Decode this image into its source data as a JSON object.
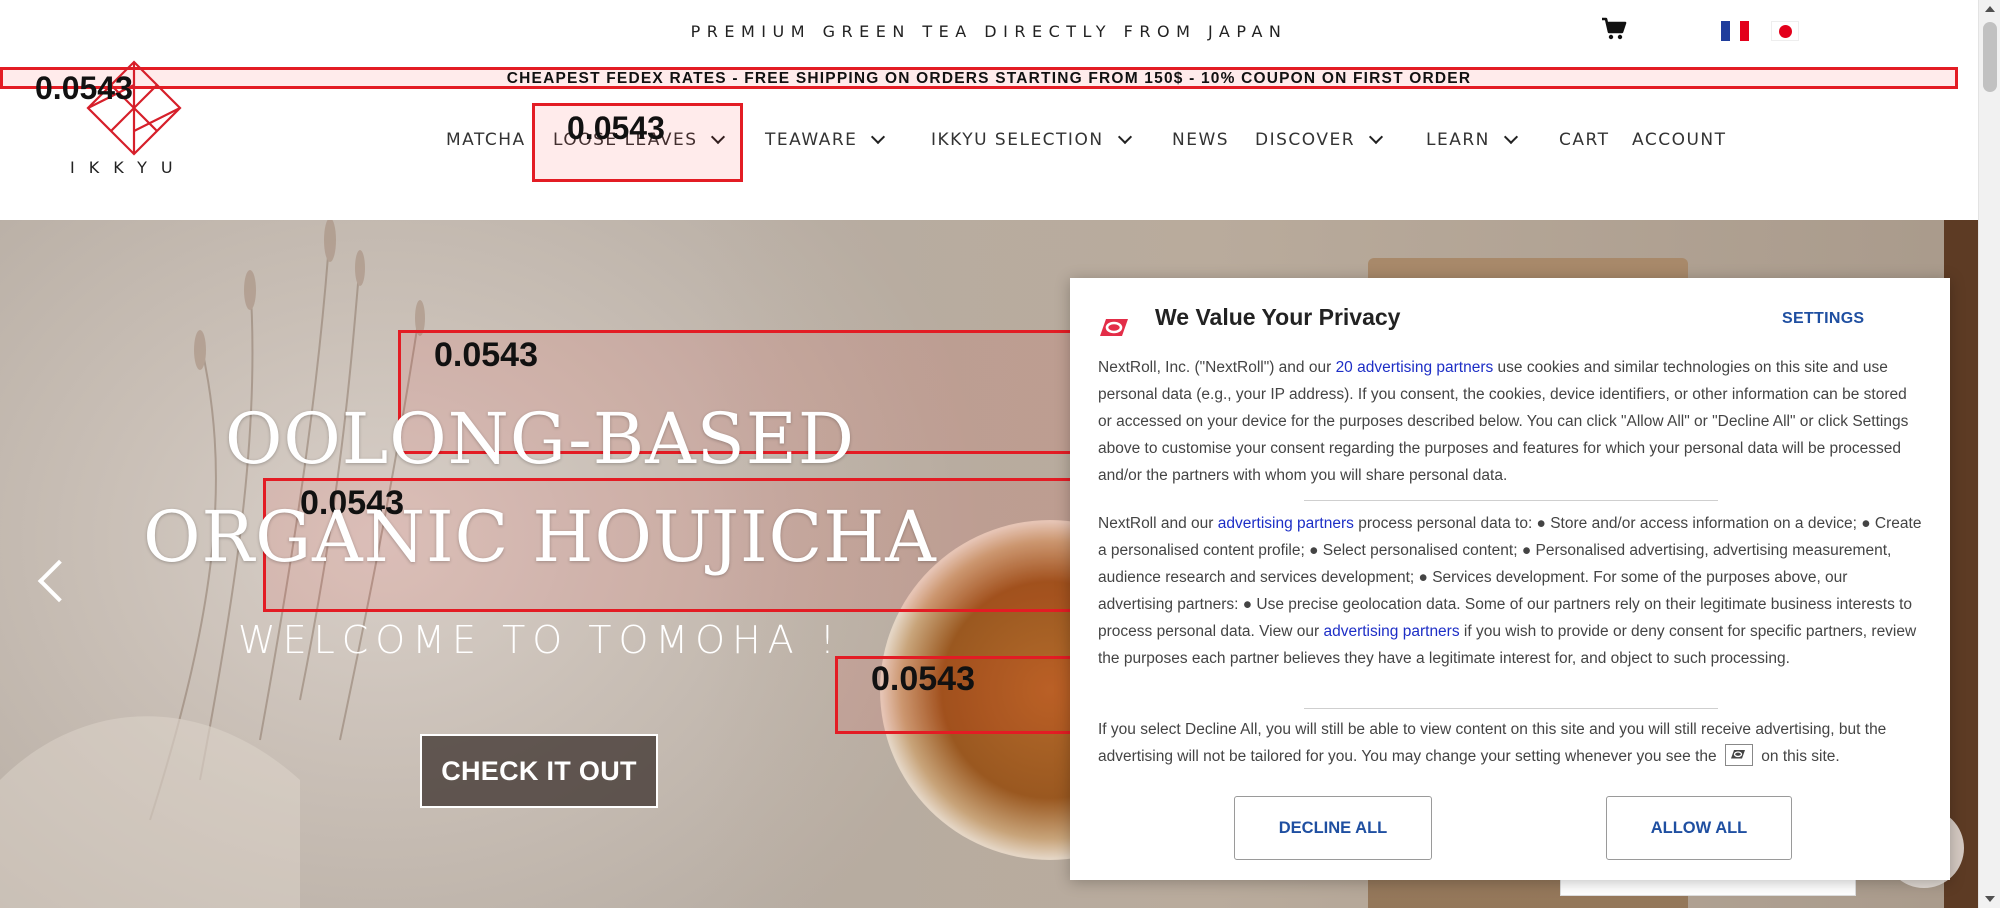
{
  "header": {
    "tagline": "PREMIUM GREEN TEA DIRECTLY FROM JAPAN",
    "shipping_banner": "CHEAPEST FEDEX RATES - FREE SHIPPING ON ORDERS STARTING FROM 150$ - 10% COUPON ON FIRST ORDER",
    "logo_text": "IKKYU",
    "icons": {
      "cart": "cart-icon",
      "french_flag": "flag-fr-icon",
      "japanese_flag": "flag-jp-icon"
    }
  },
  "nav": {
    "items": [
      {
        "label": "MATCHA",
        "dropdown": false
      },
      {
        "label": "LOOSE LEAVES",
        "dropdown": true
      },
      {
        "label": "TEAWARE",
        "dropdown": true
      },
      {
        "label": "IKKYU SELECTION",
        "dropdown": true
      },
      {
        "label": "NEWS",
        "dropdown": false
      },
      {
        "label": "DISCOVER",
        "dropdown": true
      },
      {
        "label": "LEARN",
        "dropdown": true
      },
      {
        "label": "CART",
        "dropdown": false
      },
      {
        "label": "ACCOUNT",
        "dropdown": false
      }
    ]
  },
  "hero": {
    "title_line1": "OOLONG-BASED",
    "title_line2": "ORGANIC HOUJICHA",
    "subtitle": "WELCOME TO TOMOHA !",
    "cta_label": "CHECK IT OUT"
  },
  "highlight_labels": [
    "0.0543",
    "0.0543",
    "0.0543",
    "0.0543",
    "0.0543"
  ],
  "consent": {
    "title": "We Value Your Privacy",
    "settings_label": "SETTINGS",
    "p1_a": "NextRoll, Inc. (\"NextRoll\") and our ",
    "p1_link": "20 advertising partners",
    "p1_b": " use cookies and similar technologies on this site and use personal data (e.g., your IP address). If you consent, the cookies, device identifiers, or other information can be stored or accessed on your device for the purposes described below. You can click \"Allow All\" or \"Decline All\" or click Settings above to customise your consent regarding the purposes and features for which your personal data will be processed and/or the partners with whom you will share personal data.",
    "p2_a": "NextRoll and our ",
    "p2_link1": "advertising partners",
    "p2_b": " process personal data to: ● Store and/or access information on a device; ● Create a personalised content profile; ● Select personalised content; ● Personalised advertising, advertising measurement, audience research and services development; ● Services development. For some of the purposes above, our advertising partners: ● Use precise geolocation data. Some of our partners rely on their legitimate business interests to process personal data. View our ",
    "p2_link2": "advertising partners",
    "p2_c": " if you wish to provide or deny consent for specific partners, review the purposes each partner believes they have a legitimate interest for, and object to such processing.",
    "p3_a": "If you select Decline All, you will still be able to view content on this site and you will still receive advertising, but the advertising will not be tailored for you. You may change your setting whenever you see the ",
    "p3_b": " on this site.",
    "decline_label": "DECLINE ALL",
    "allow_label": "ALLOW ALL"
  },
  "colors": {
    "highlight": "#e31c24",
    "link": "#1d2ec6",
    "button_text": "#1f4fa1",
    "hero_bg": "#c9bfb6"
  }
}
